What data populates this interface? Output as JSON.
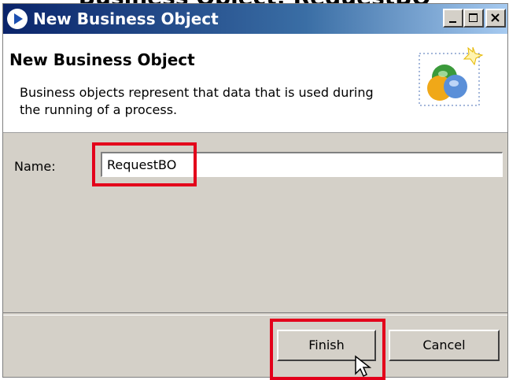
{
  "page_top_text": "Business Object: RequestBO",
  "window": {
    "title": "New Business Object",
    "caption_buttons": [
      "minimize-icon",
      "maximize-icon",
      "close-icon"
    ]
  },
  "banner": {
    "title": "New Business Object",
    "description": "Business objects represent that data that is used during the running of a process.",
    "image_icon": "business-object-wizard-icon"
  },
  "form": {
    "name_label": "Name:",
    "name_value": "RequestBO"
  },
  "buttons": {
    "finish": "Finish",
    "cancel": "Cancel"
  },
  "highlight_color": "#e3001b"
}
